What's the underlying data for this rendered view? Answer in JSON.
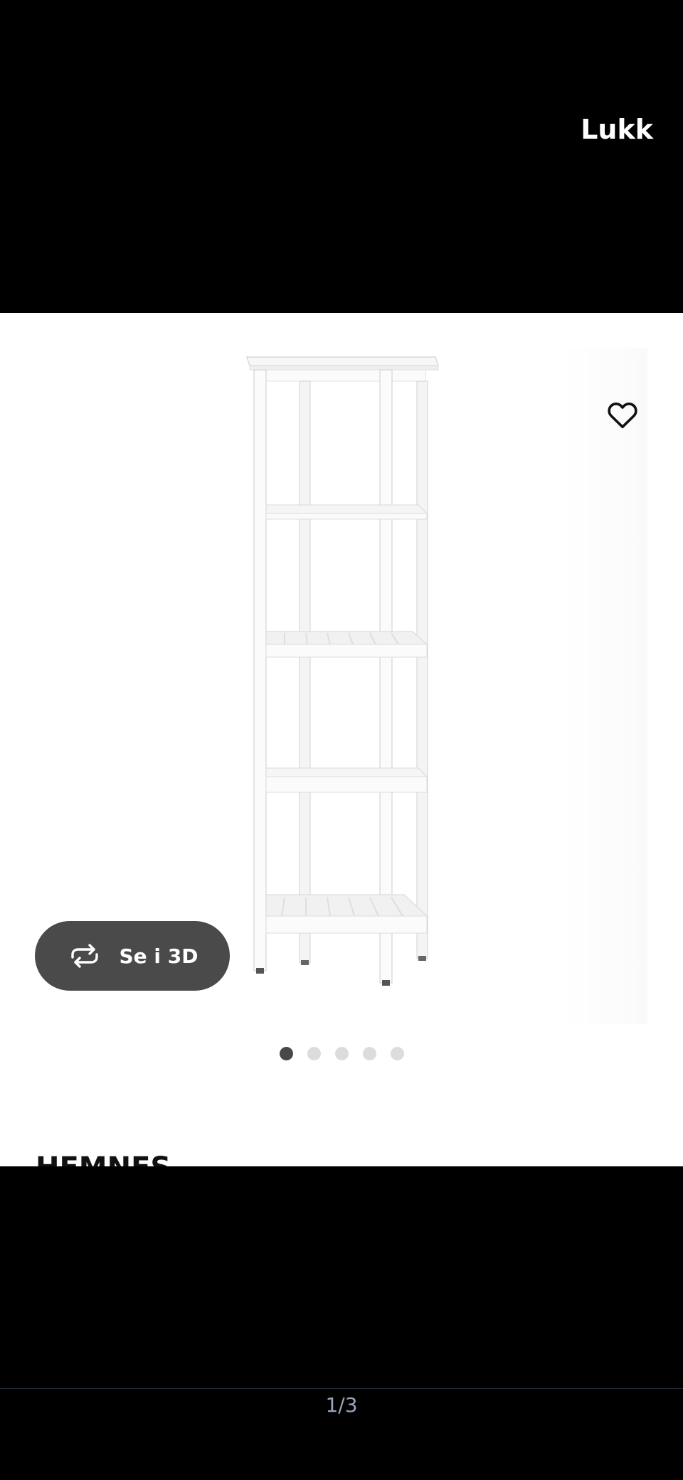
{
  "header": {
    "close_label": "Lukk"
  },
  "product": {
    "name": "HEMNES",
    "favorite_icon": "heart-outline-icon",
    "view_3d": {
      "label": "Se i 3D",
      "icon": "rotate-arrows-icon"
    },
    "carousel": {
      "total": 5,
      "active_index": 0
    }
  },
  "viewer": {
    "counter": "1/3"
  },
  "colors": {
    "background": "#000000",
    "button_bg": "#4a4a4a",
    "active_dot": "#484848",
    "inactive_dot": "#dcdcdc",
    "counter_text": "#9aa4ba"
  }
}
